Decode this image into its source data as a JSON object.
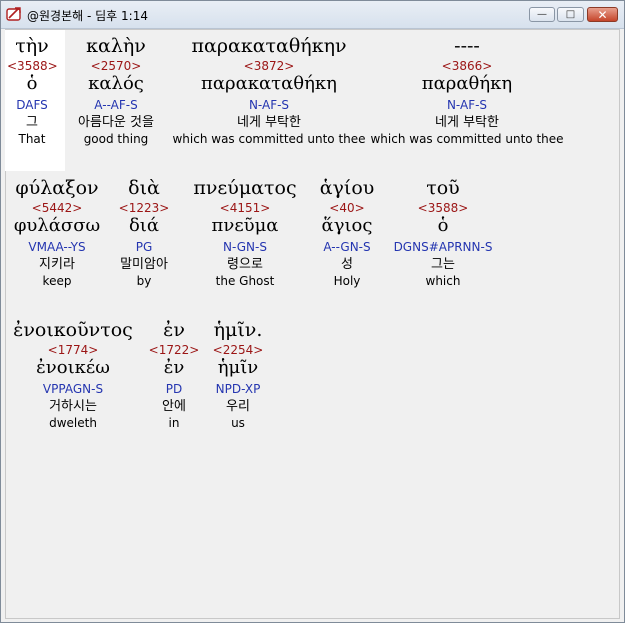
{
  "window": {
    "title": "@원경본해 - 딤후 1:14",
    "controls": {
      "minimize": "—",
      "maximize": "□",
      "close": "✕"
    }
  },
  "words": [
    {
      "greek": "τὴν",
      "strong": "<3588>",
      "lemma": "ὁ",
      "parse": "DAFS",
      "korean": "그",
      "english": "That"
    },
    {
      "greek": "καλὴν",
      "strong": "<2570>",
      "lemma": "καλός",
      "parse": "A--AF-S",
      "korean": "아름다운 것을",
      "english": "good thing"
    },
    {
      "greek": "παρακαταθήκην",
      "strong": "<3872>",
      "lemma": "παρακαταθήκη",
      "parse": "N-AF-S",
      "korean": "네게 부탁한",
      "english": "which was committed unto thee"
    },
    {
      "greek": "----",
      "strong": "<3866>",
      "lemma": "παραθήκη",
      "parse": "N-AF-S",
      "korean": "네게 부탁한",
      "english": "which was committed unto thee"
    },
    {
      "greek": "φύλαξον",
      "strong": "<5442>",
      "lemma": "φυλάσσω",
      "parse": "VMAA--YS",
      "korean": "지키라",
      "english": "keep"
    },
    {
      "greek": "διὰ",
      "strong": "<1223>",
      "lemma": "διά",
      "parse": "PG",
      "korean": "말미암아",
      "english": "by"
    },
    {
      "greek": "πνεύματος",
      "strong": "<4151>",
      "lemma": "πνεῦμα",
      "parse": "N-GN-S",
      "korean": "령으로",
      "english": "the Ghost"
    },
    {
      "greek": "ἁγίου",
      "strong": "<40>",
      "lemma": "ἅγιος",
      "parse": "A--GN-S",
      "korean": "성",
      "english": "Holy"
    },
    {
      "greek": "τοῦ",
      "strong": "<3588>",
      "lemma": "ὁ",
      "parse": "DGNS#APRNN-S",
      "korean": "그는",
      "english": "which"
    },
    {
      "greek": "ἐνοικοῦντος",
      "strong": "<1774>",
      "lemma": "ἐνοικέω",
      "parse": "VPPAGN-S",
      "korean": "거하시는",
      "english": "dweleth"
    },
    {
      "greek": "ἐν",
      "strong": "<1722>",
      "lemma": "ἐν",
      "parse": "PD",
      "korean": "안에",
      "english": "in"
    },
    {
      "greek": "ἡμῖν.",
      "strong": "<2254>",
      "lemma": "ἡμῖν",
      "parse": "NPD-XP",
      "korean": "우리",
      "english": "us"
    }
  ]
}
